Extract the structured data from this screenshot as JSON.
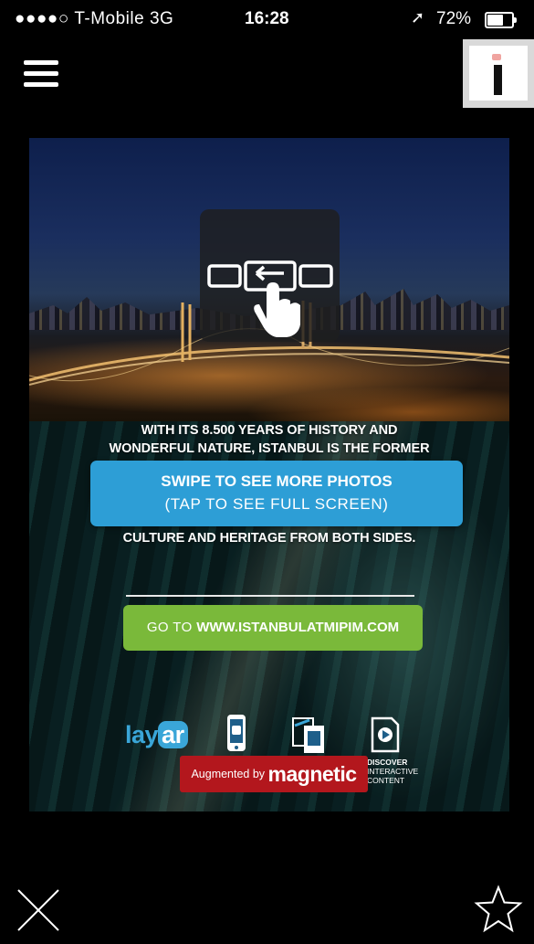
{
  "status_bar": {
    "carrier": "●●●●○ T-Mobile  3G",
    "time": "16:28",
    "battery": "72%",
    "battery_level": 0.72
  },
  "header": {
    "menu_icon": "hamburger-menu-icon",
    "info_icon": "info-icon"
  },
  "content": {
    "line1": "WITH ITS 8.500 YEARS OF HISTORY AND",
    "line2": "WONDERFUL NATURE, ISTANBUL IS THE FORMER",
    "line3": "CULTURE AND HERITAGE FROM BOTH SIDES.",
    "swipe_title": "SWIPE TO SEE MORE PHOTOS",
    "swipe_sub": "(TAP TO SEE FULL SCREEN)",
    "cta_prefix": "GO TO ",
    "cta_url": "WWW.ISTANBULATMIPIM.COM",
    "layar_lay": "lay",
    "layar_ar": "ar",
    "augmented_by": "Augmented by ",
    "magnetic": "magnetic",
    "discover_1": "DISCOVER",
    "discover_2": "INTERACTIVE",
    "discover_3": "CONTENT"
  },
  "colors": {
    "swipe_banner": "#2d9ed6",
    "cta": "#7ab93a",
    "magnetic": "#b3171d",
    "layar": "#3aa6d8"
  },
  "footer": {
    "close_icon": "close-x-icon",
    "favorite_icon": "star-outline-icon"
  }
}
